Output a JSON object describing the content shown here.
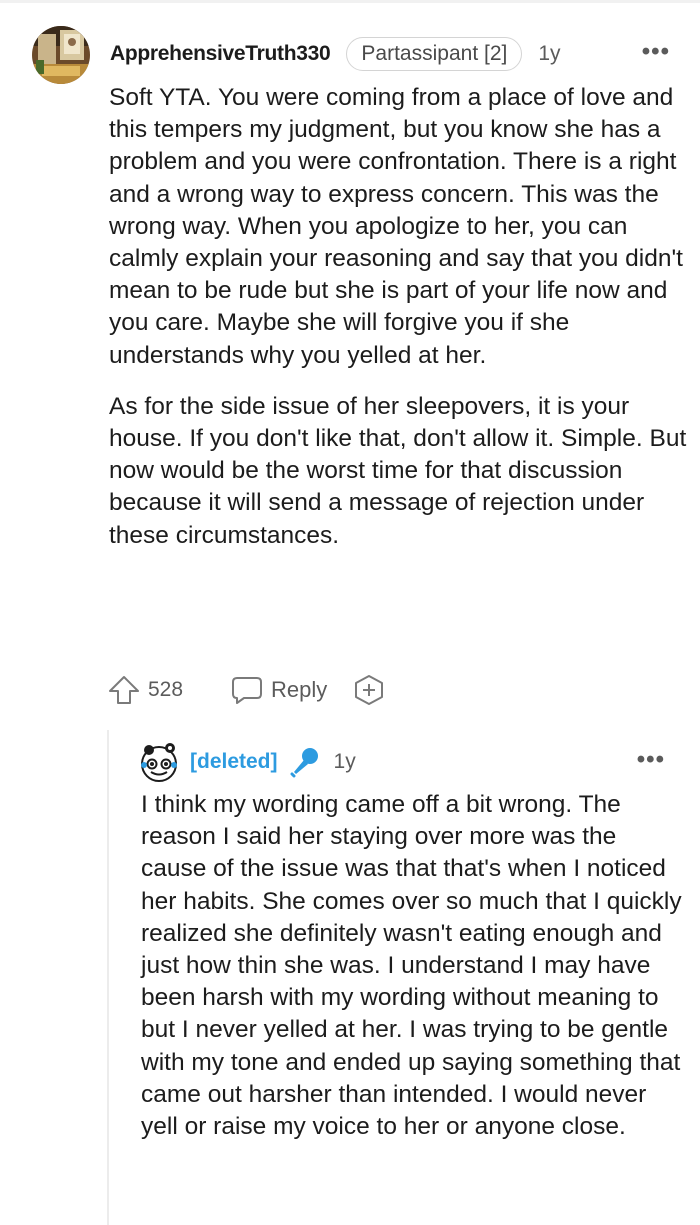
{
  "main_comment": {
    "username": "ApprehensiveTruth330",
    "flair": "Partassipant [2]",
    "age": "1y",
    "more_label": "•••",
    "paragraphs": [
      "Soft YTA. You were coming from a place of love and this tempers my judgment, but you know she has a problem and you were confrontation. There is a right and a wrong way to express concern. This was the wrong way. When you apologize to her, you can calmly explain your reasoning and say that you didn't mean to be rude but she is part of your life now and you care. Maybe she will forgive you if she understands why you yelled at her.",
      "As for the side issue of her sleepovers, it is your house. If you don't like that, don't allow it. Simple. But now would be the worst time for that discussion because it will send a message of rejection under these circumstances."
    ],
    "actions": {
      "upvotes": "528",
      "reply_label": "Reply"
    }
  },
  "reply_comment": {
    "username": "[deleted]",
    "age": "1y",
    "more_label": "•••",
    "body": "I think my wording came off a bit wrong. The reason I said her staying over more was the cause of the issue was that that's when I noticed her habits. She comes over so much that I quickly realized she definitely wasn't eating enough and just how thin she was. I understand I may have been harsh with my wording without meaning to but I never yelled at her. I was trying to be gentle with my tone and ended up saying something that came out harsher than intended. I would never yell or raise my voice to her or anyone close."
  },
  "icons": {
    "upvote": "upvote-arrow-icon",
    "reply": "speech-bubble-icon",
    "award": "add-award-icon",
    "mic": "microphone-icon",
    "snoo": "snoo-avatar-icon"
  },
  "colors": {
    "deleted_user": "#2d9be0",
    "text": "#1c1c1c",
    "meta": "#5b5b5b"
  }
}
